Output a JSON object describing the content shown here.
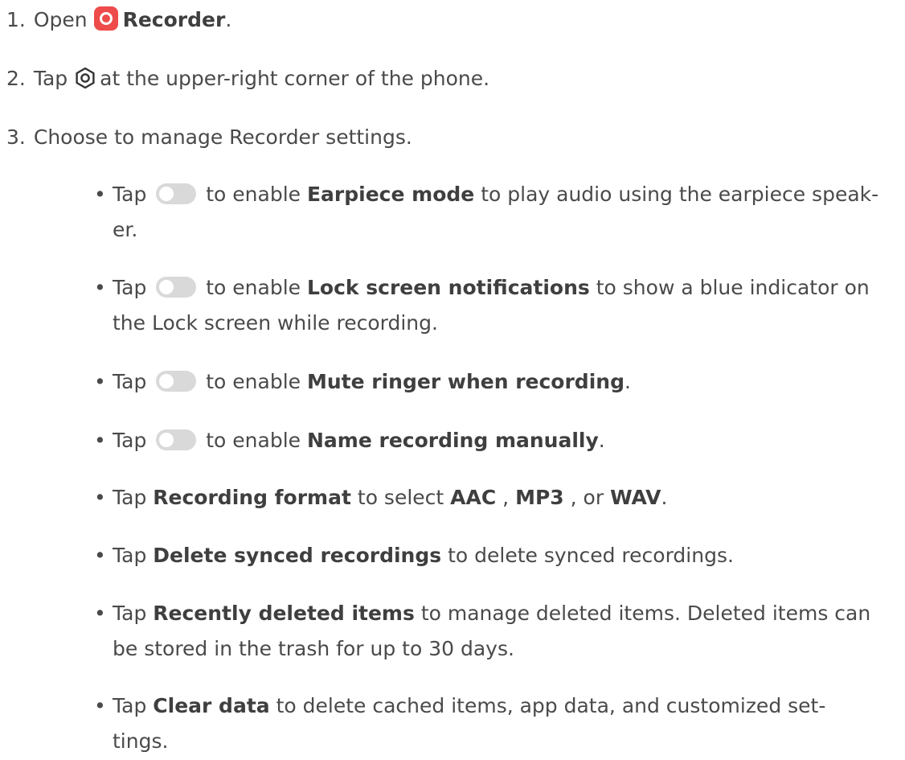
{
  "steps": [
    {
      "num": "1.",
      "before": "Open",
      "bold": "Recorder",
      "after": ".",
      "icon": "recorder-app-icon"
    },
    {
      "num": "2.",
      "before": "Tap",
      "after": "at the upper-right corner of the phone.",
      "icon": "settings-icon"
    },
    {
      "num": "3.",
      "text": "Choose to manage Recorder settings."
    }
  ],
  "bullets": [
    {
      "marker": "•",
      "before": "Tap",
      "mid": "to enable",
      "bold": "Earpiece mode",
      "after": "to play audio using the earpiece speak-",
      "line2": "er.",
      "icon": "toggle-icon"
    },
    {
      "marker": "•",
      "before": "Tap",
      "mid": "to enable",
      "bold": "Lock screen notifications",
      "after": "to show a blue indicator on",
      "line2": "the Lock screen while recording.",
      "icon": "toggle-icon"
    },
    {
      "marker": "•",
      "before": "Tap",
      "mid": "to enable",
      "bold": "Mute ringer when recording",
      "after": ".",
      "icon": "toggle-icon"
    },
    {
      "marker": "•",
      "before": "Tap",
      "mid": "to enable",
      "bold": "Name recording manually",
      "after": ".",
      "icon": "toggle-icon"
    },
    {
      "marker": "•",
      "before": "Tap",
      "bold": "Recording format",
      "mid": "to select",
      "opt1": "AAC",
      "sep1": ",",
      "opt2": "MP3",
      "sep2": ", or",
      "opt3": "WAV",
      "after": "."
    },
    {
      "marker": "•",
      "before": "Tap",
      "bold": "Delete synced recordings",
      "after": "to delete synced recordings."
    },
    {
      "marker": "•",
      "before": "Tap",
      "bold": "Recently deleted items",
      "after": "to manage deleted items. Deleted items can",
      "line2": "be stored in the trash for up to 30 days."
    },
    {
      "marker": "•",
      "before": "Tap",
      "bold": "Clear data",
      "after": "to delete cached items, app data, and customized set-",
      "line2": "tings."
    }
  ],
  "colors": {
    "recorder_icon": "#ee4b4b",
    "toggle_off": "#d9d9d9",
    "text": "#4a4a4a"
  }
}
